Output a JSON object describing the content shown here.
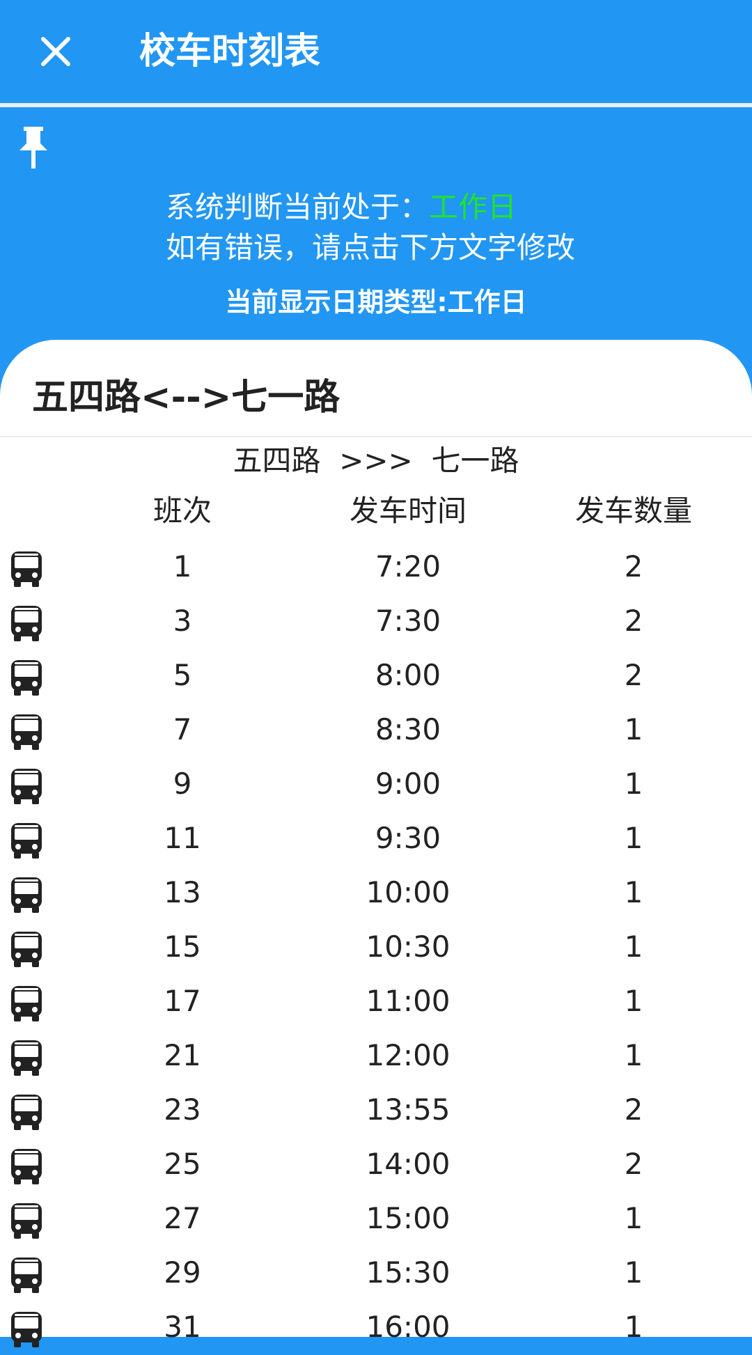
{
  "appbar": {
    "title": "校车时刻表",
    "close_icon": "close-icon"
  },
  "info": {
    "pin_icon": "pin-icon",
    "line1_prefix": "系统判断当前处于：",
    "current_day_type": "工作日",
    "line2": "如有错误，请点击下方文字修改",
    "line3": "当前显示日期类型:工作日",
    "day_type_color": "#1EE32E"
  },
  "route": {
    "title": "五四路<-->七一路",
    "direction": "五四路  >>>  七一路",
    "headers": {
      "trip": "班次",
      "time": "发车时间",
      "count": "发车数量"
    },
    "rows": [
      {
        "trip": "1",
        "time": "7:20",
        "count": "2"
      },
      {
        "trip": "3",
        "time": "7:30",
        "count": "2"
      },
      {
        "trip": "5",
        "time": "8:00",
        "count": "2"
      },
      {
        "trip": "7",
        "time": "8:30",
        "count": "1"
      },
      {
        "trip": "9",
        "time": "9:00",
        "count": "1"
      },
      {
        "trip": "11",
        "time": "9:30",
        "count": "1"
      },
      {
        "trip": "13",
        "time": "10:00",
        "count": "1"
      },
      {
        "trip": "15",
        "time": "10:30",
        "count": "1"
      },
      {
        "trip": "17",
        "time": "11:00",
        "count": "1"
      },
      {
        "trip": "21",
        "time": "12:00",
        "count": "1"
      },
      {
        "trip": "23",
        "time": "13:55",
        "count": "2"
      },
      {
        "trip": "25",
        "time": "14:00",
        "count": "2"
      },
      {
        "trip": "27",
        "time": "15:00",
        "count": "1"
      },
      {
        "trip": "29",
        "time": "15:30",
        "count": "1"
      },
      {
        "trip": "31",
        "time": "16:00",
        "count": "1"
      }
    ],
    "row_icon": "bus-icon"
  },
  "colors": {
    "primary": "#2196F3",
    "text": "#222222"
  }
}
